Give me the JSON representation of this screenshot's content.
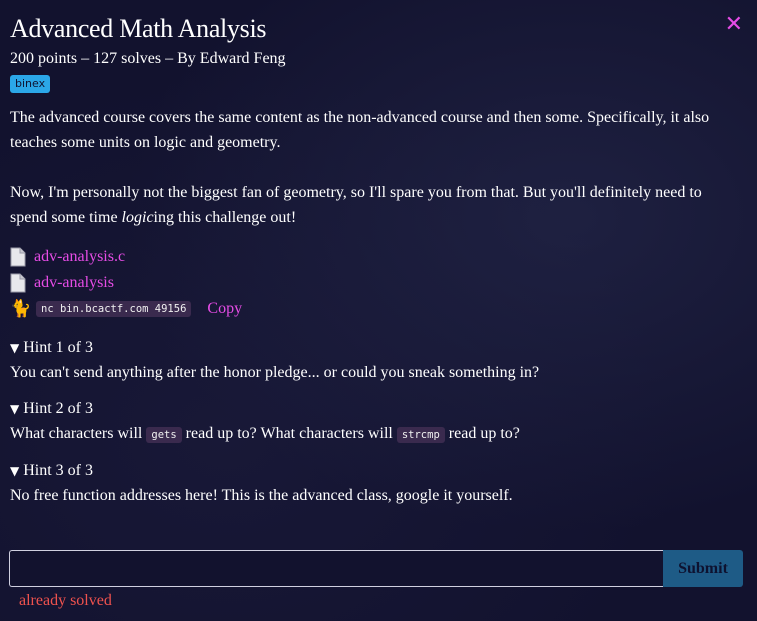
{
  "challenge": {
    "title": "Advanced Math Analysis",
    "meta": "200 points – 127 solves – By Edward Feng",
    "tag": "binex",
    "description": {
      "p1": "The advanced course covers the same content as the non-advanced course and then some. Specifically, it also teaches some units on logic and geometry.",
      "p2_before": "Now, I'm personally not the biggest fan of geometry, so I'll spare you from that. But you'll definitely need to spend some time ",
      "p2_italic": "logic",
      "p2_after": "ing this challenge out!"
    },
    "files": [
      {
        "name": "adv-analysis.c",
        "icon": "file-icon"
      },
      {
        "name": "adv-analysis",
        "icon": "file-icon"
      }
    ],
    "connection": {
      "icon": "cat-icon",
      "command": "nc bin.bcactf.com 49156",
      "copy_label": "Copy"
    },
    "hints": [
      {
        "summary": "Hint 1 of 3",
        "text": "You can't send anything after the honor pledge... or could you sneak something in?"
      },
      {
        "summary": "Hint 2 of 3",
        "text_a": "What characters will ",
        "code_a": "gets",
        "text_b": " read up to? What characters will ",
        "code_b": "strcmp",
        "text_c": " read up to?"
      },
      {
        "summary": "Hint 3 of 3",
        "text": "No free function addresses here! This is the advanced class, google it yourself."
      }
    ],
    "flag_input": {
      "value": "",
      "placeholder": ""
    },
    "submit_label": "Submit",
    "status": "already solved"
  },
  "colors": {
    "background": "#12122e",
    "accent_link": "#e64ce6",
    "tag": "#2ba7e8",
    "submit": "#1e5b86",
    "solved": "#f0524e"
  }
}
